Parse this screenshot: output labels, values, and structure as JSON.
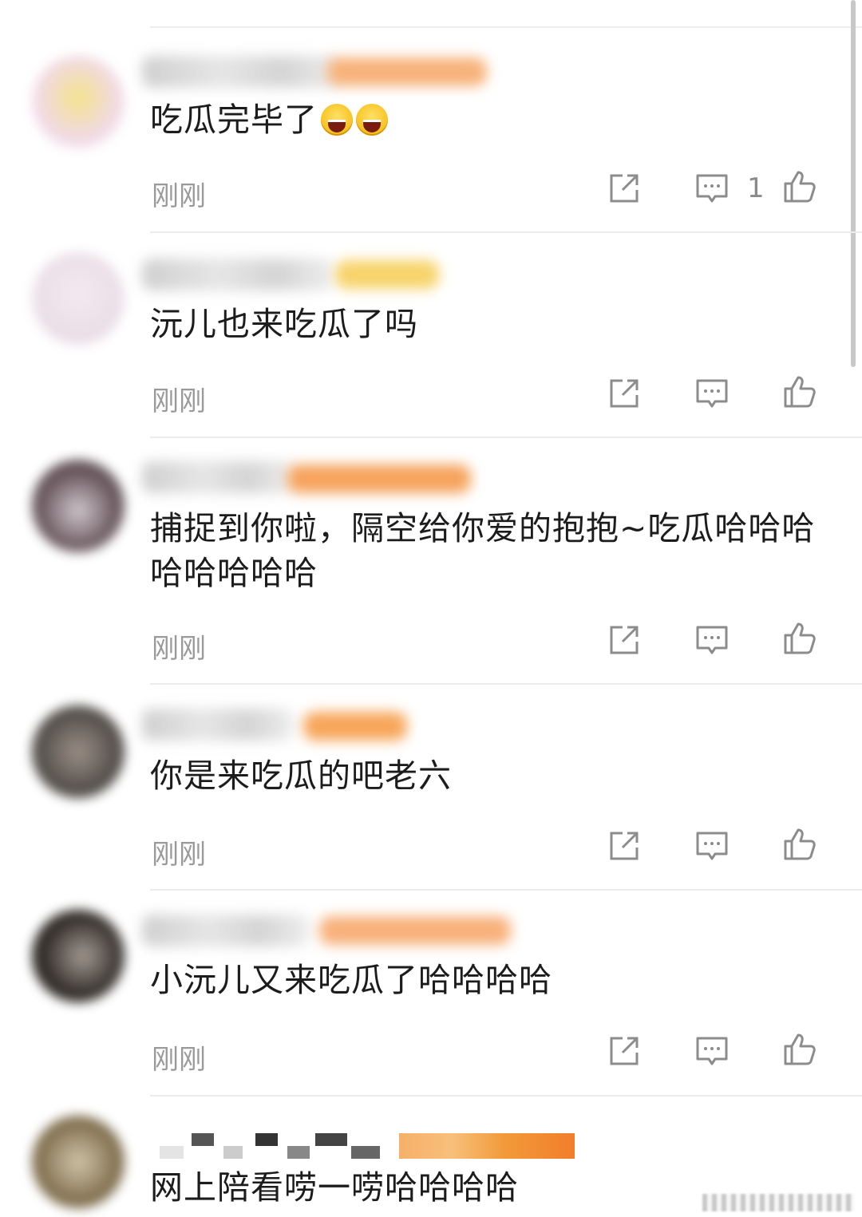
{
  "comments": [
    {
      "text": "吃瓜完毕了",
      "emoji_count": 2,
      "time": "刚刚",
      "reply_count": "1",
      "avatar_colors": [
        "#f1d9e6",
        "#f4e38c"
      ],
      "badge_color": "#f7b27a"
    },
    {
      "text": "沅儿也来吃瓜了吗",
      "time": "刚刚",
      "avatar_colors": [
        "#eadde6",
        "#f3e9ef"
      ],
      "badge_color": "#f7d36a"
    },
    {
      "text": "捕捉到你啦，隔空给你爱的抱抱~吃瓜哈哈哈哈哈哈哈哈",
      "time": "刚刚",
      "avatar_colors": [
        "#4b3c40",
        "#cfc6cb"
      ],
      "badge_color": "#f6a35d"
    },
    {
      "text": "你是来吃瓜的吧老六",
      "time": "刚刚",
      "avatar_colors": [
        "#4e4a46",
        "#9b8f86"
      ],
      "badge_color": "#f7a65a"
    },
    {
      "text": "小沅儿又来吃瓜了哈哈哈哈",
      "time": "刚刚",
      "avatar_colors": [
        "#2f2a26",
        "#a39a92"
      ],
      "badge_color": "#f8b07a"
    },
    {
      "text": "网上陪看唠一唠哈哈哈哈",
      "avatar_colors": [
        "#7d6b4a",
        "#cfc4a8"
      ],
      "badge_color": "#f27d2a"
    }
  ],
  "icons": {
    "share": "share-icon",
    "comment": "comment-icon",
    "like": "like-icon"
  },
  "colors": {
    "divider": "#ececec",
    "time": "#9a9a9a",
    "icon": "#8c8c8c"
  }
}
